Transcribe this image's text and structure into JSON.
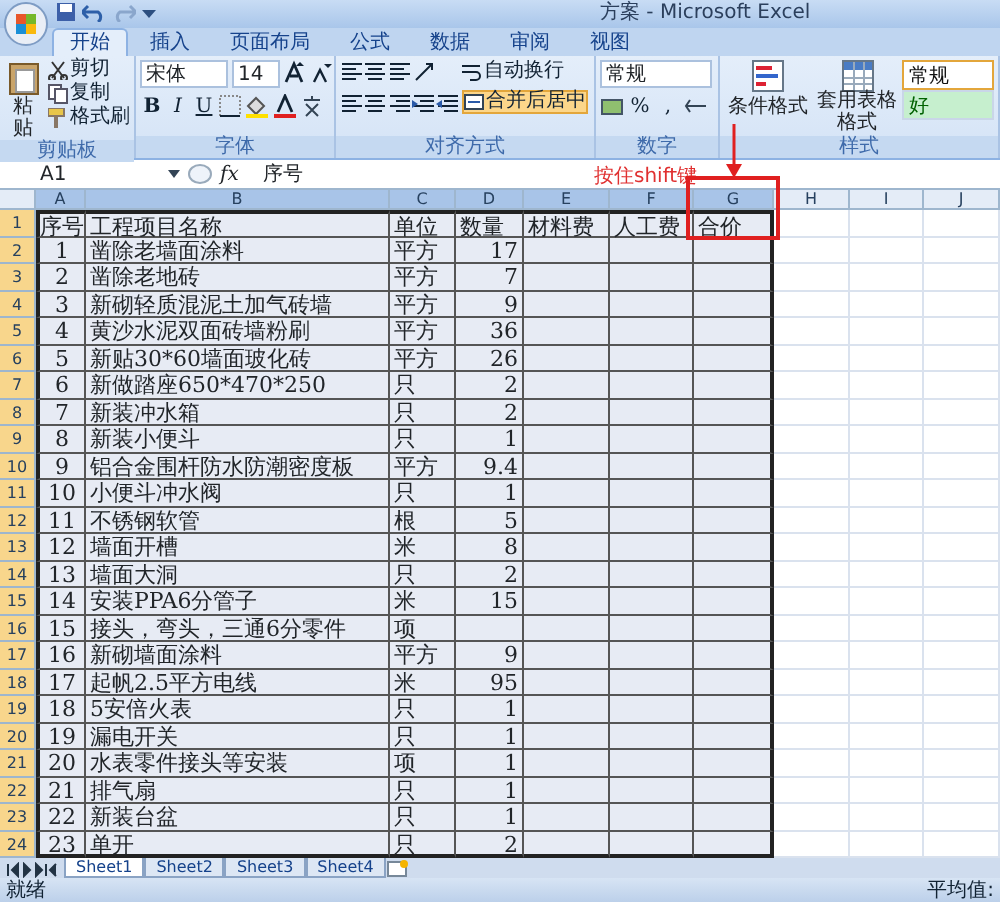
{
  "window": {
    "title": "方案 - Microsoft Excel"
  },
  "ribbon_tabs": [
    {
      "label": "开始",
      "selected": true
    },
    {
      "label": "插入",
      "selected": false
    },
    {
      "label": "页面布局",
      "selected": false
    },
    {
      "label": "公式",
      "selected": false
    },
    {
      "label": "数据",
      "selected": false
    },
    {
      "label": "审阅",
      "selected": false
    },
    {
      "label": "视图",
      "selected": false
    }
  ],
  "clipboard": {
    "label": "剪贴板",
    "paste": "粘贴",
    "actions": [
      "剪切",
      "复制",
      "格式刷"
    ]
  },
  "font": {
    "label": "字体",
    "name": "宋体",
    "size": "14",
    "styles": [
      "B",
      "I",
      "U"
    ]
  },
  "alignment": {
    "label": "对齐方式",
    "wrap": "自动换行",
    "merge": {
      "label": "合并后居中",
      "highlighted": true
    }
  },
  "number": {
    "label": "数字",
    "format": "常规",
    "symbols": [
      "%",
      ","
    ]
  },
  "styles": {
    "label": "样式",
    "conditional": "条件格式",
    "table_format": "套用表格格式",
    "cell_styles": [
      {
        "label": "常规",
        "kind": "normal",
        "selected": true
      },
      {
        "label": "好",
        "kind": "good",
        "selected": false
      }
    ]
  },
  "formula_bar": {
    "name_box": "A1",
    "function_label": "fx",
    "formula": "序号"
  },
  "annotation": {
    "text": "按住shift键"
  },
  "columns": [
    {
      "label": "A",
      "selected": true
    },
    {
      "label": "B",
      "selected": true
    },
    {
      "label": "C",
      "selected": true
    },
    {
      "label": "D",
      "selected": true
    },
    {
      "label": "E",
      "selected": true
    },
    {
      "label": "F",
      "selected": true
    },
    {
      "label": "G",
      "selected": true
    },
    {
      "label": "H",
      "selected": false
    },
    {
      "label": "I",
      "selected": false
    },
    {
      "label": "J",
      "selected": false
    }
  ],
  "rows": [
    {
      "header": "1",
      "selected": true,
      "kind": "header",
      "cells": [
        "序号",
        "工程项目名称",
        "单位",
        "数量",
        "材料费",
        "人工费",
        "合价"
      ]
    },
    {
      "header": "2",
      "selected": true,
      "kind": "item",
      "cells": [
        "1",
        "凿除老墙面涂料",
        "平方",
        "17"
      ]
    },
    {
      "header": "3",
      "selected": true,
      "kind": "item",
      "cells": [
        "2",
        "凿除老地砖",
        "平方",
        "7"
      ]
    },
    {
      "header": "4",
      "selected": true,
      "kind": "item",
      "cells": [
        "3",
        "新砌轻质混泥土加气砖墙",
        "平方",
        "9"
      ]
    },
    {
      "header": "5",
      "selected": true,
      "kind": "item",
      "cells": [
        "4",
        "黄沙水泥双面砖墙粉刷",
        "平方",
        "36"
      ]
    },
    {
      "header": "6",
      "selected": true,
      "kind": "item",
      "cells": [
        "5",
        "新贴30*60墙面玻化砖",
        "平方",
        "26"
      ]
    },
    {
      "header": "7",
      "selected": true,
      "kind": "item",
      "cells": [
        "6",
        "新做踏座650*470*250",
        "只",
        "2"
      ]
    },
    {
      "header": "8",
      "selected": true,
      "kind": "item",
      "cells": [
        "7",
        "新装冲水箱",
        "只",
        "2"
      ]
    },
    {
      "header": "9",
      "selected": true,
      "kind": "item",
      "cells": [
        "8",
        "新装小便斗",
        "只",
        "1"
      ]
    },
    {
      "header": "10",
      "selected": true,
      "kind": "item",
      "cells": [
        "9",
        "铝合金围杆防水防潮密度板",
        "平方",
        "9.4"
      ]
    },
    {
      "header": "11",
      "selected": true,
      "kind": "item",
      "cells": [
        "10",
        "小便斗冲水阀",
        "只",
        "1"
      ]
    },
    {
      "header": "12",
      "selected": true,
      "kind": "item",
      "cells": [
        "11",
        "不锈钢软管",
        "根",
        "5"
      ]
    },
    {
      "header": "13",
      "selected": true,
      "kind": "item",
      "cells": [
        "12",
        "墙面开槽",
        "米",
        "8"
      ]
    },
    {
      "header": "14",
      "selected": true,
      "kind": "item",
      "cells": [
        "13",
        "墙面大洞",
        "只",
        "2"
      ]
    },
    {
      "header": "15",
      "selected": true,
      "kind": "item",
      "cells": [
        "14",
        "安装PPA6分管子",
        "米",
        "15"
      ]
    },
    {
      "header": "16",
      "selected": true,
      "kind": "item",
      "cells": [
        "15",
        "接头，弯头，三通6分零件",
        "项"
      ]
    },
    {
      "header": "17",
      "selected": true,
      "kind": "item",
      "cells": [
        "16",
        "新砌墙面涂料",
        "平方",
        "9"
      ]
    },
    {
      "header": "18",
      "selected": true,
      "kind": "item",
      "cells": [
        "17",
        "起帆2.5平方电线",
        "米",
        "95"
      ]
    },
    {
      "header": "19",
      "selected": true,
      "kind": "item",
      "cells": [
        "18",
        "5安倍火表",
        "只",
        "1"
      ]
    },
    {
      "header": "20",
      "selected": true,
      "kind": "item",
      "cells": [
        "19",
        "漏电开关",
        "只",
        "1"
      ]
    },
    {
      "header": "21",
      "selected": true,
      "kind": "item",
      "cells": [
        "20",
        "水表零件接头等安装",
        "项",
        "1"
      ]
    },
    {
      "header": "22",
      "selected": true,
      "kind": "item",
      "cells": [
        "21",
        "排气扇",
        "只",
        "1"
      ]
    },
    {
      "header": "23",
      "selected": true,
      "kind": "item",
      "cells": [
        "22",
        "新装台盆",
        "只",
        "1"
      ]
    },
    {
      "header": "24",
      "selected": true,
      "kind": "item",
      "cells": [
        "23",
        "单开",
        "只",
        "2"
      ]
    }
  ],
  "sheet_tabs": [
    {
      "label": "Sheet1",
      "selected": true
    },
    {
      "label": "Sheet2",
      "selected": false
    },
    {
      "label": "Sheet3",
      "selected": false
    },
    {
      "label": "Sheet4",
      "selected": false
    }
  ],
  "status_bar": {
    "left": "就绪",
    "right": "平均值:"
  }
}
